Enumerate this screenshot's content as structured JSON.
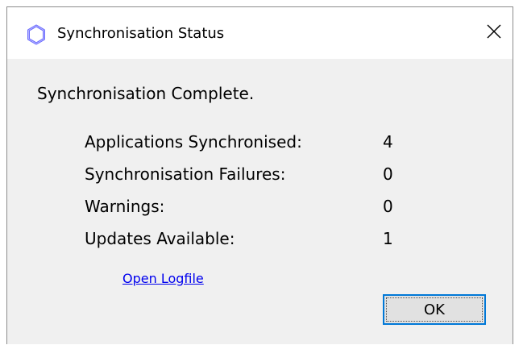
{
  "window": {
    "title": "Synchronisation Status",
    "app_icon": "hexagon-ring-icon",
    "close_icon": "close-icon",
    "accent_color": "#0078d7"
  },
  "content": {
    "heading": "Synchronisation Complete.",
    "stats": [
      {
        "label": "Applications Synchronised:",
        "value": "4"
      },
      {
        "label": "Synchronisation Failures:",
        "value": "0"
      },
      {
        "label": "Warnings:",
        "value": "0"
      },
      {
        "label": "Updates Available:",
        "value": "1"
      }
    ],
    "logfile_link": "Open Logfile"
  },
  "buttons": {
    "ok_label": "OK"
  }
}
